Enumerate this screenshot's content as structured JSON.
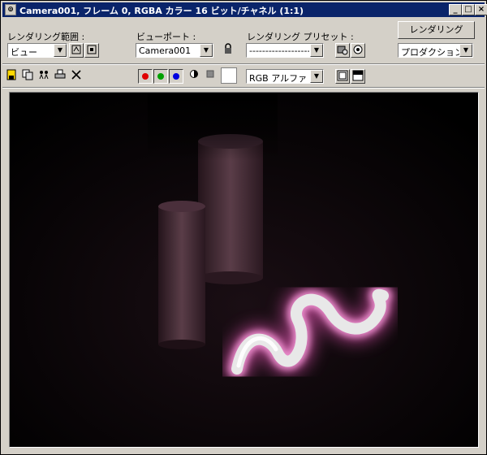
{
  "window": {
    "title": "Camera001, フレーム 0, RGBA カラー 16 ビット/チャネル (1:1)",
    "buttons": {
      "minimize": "_",
      "maximize": "□",
      "close": "×"
    }
  },
  "controls": {
    "render_area_label": "レンダリング範囲 :",
    "render_area_value": "ビュー",
    "viewport_label": "ビューポート :",
    "viewport_value": "Camera001",
    "preset_label": "レンダリング プリセット :",
    "preset_value": "--------------------------------",
    "render_button": "レンダリング",
    "production_value": "プロダクション"
  },
  "toolbar": {
    "channel_display_value": "RGB アルファ",
    "channel_colors": {
      "red": "#e00000",
      "green": "#00a000",
      "blue": "#0000e0"
    }
  },
  "scene": {
    "background": "#000000",
    "glow_color": "#ff5fc8",
    "tube_color": "#e8e8e8",
    "cylinder_color": "#6a4a55"
  }
}
